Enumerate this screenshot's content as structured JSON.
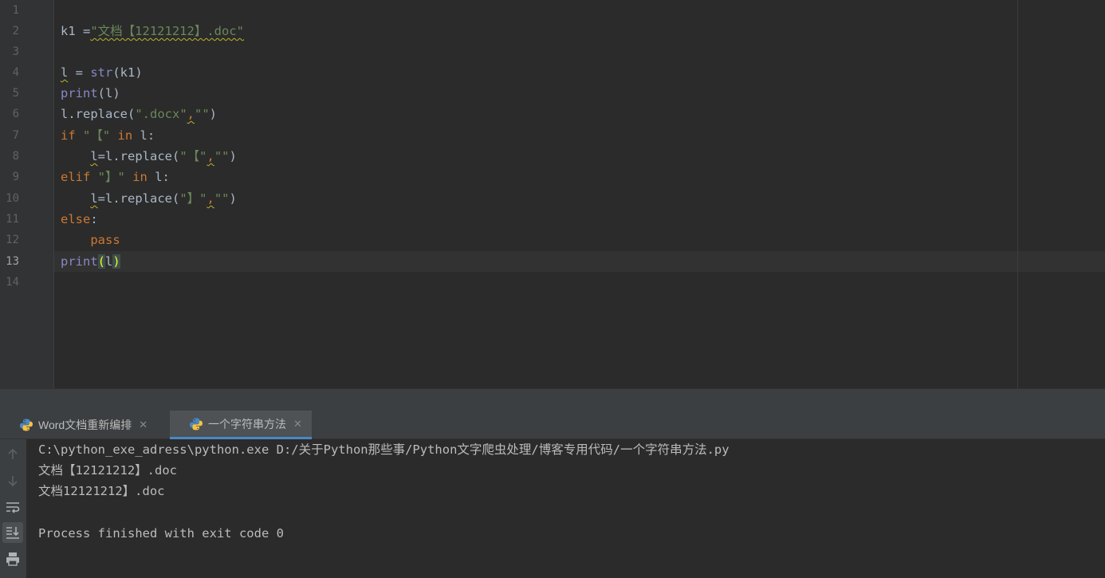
{
  "editor": {
    "line_numbers": [
      "1",
      "2",
      "3",
      "4",
      "5",
      "6",
      "7",
      "8",
      "9",
      "10",
      "11",
      "12",
      "13",
      "14"
    ],
    "current_line": "13",
    "code": {
      "l2": {
        "a": "k1 =",
        "b": "\"文档【12121212】.doc\""
      },
      "l4": {
        "a": "l",
        "b": " = ",
        "c": "str",
        "d": "(k1)"
      },
      "l5": {
        "a": "print",
        "b": "(l)"
      },
      "l6": {
        "a": "l.replace(",
        "b": "\".docx\"",
        "c": ",",
        "d": "\"\"",
        "e": ")"
      },
      "l7": {
        "a": "if",
        "b": " ",
        "c": "\"【\"",
        "d": " ",
        "e": "in",
        "f": " l:"
      },
      "l8": {
        "indent": "    ",
        "a": "l",
        "b": "=l.replace(",
        "c": "\"【\"",
        "d": ",",
        "e": "\"\"",
        "f": ")"
      },
      "l9": {
        "a": "elif",
        "b": " ",
        "c": "\"】\"",
        "d": " ",
        "e": "in",
        "f": " l:"
      },
      "l10": {
        "indent": "    ",
        "a": "l",
        "b": "=l.replace(",
        "c": "\"】\"",
        "d": ",",
        "e": "\"\"",
        "f": ")"
      },
      "l11": {
        "a": "else",
        "b": ":"
      },
      "l12": {
        "indent": "    ",
        "a": "pass"
      },
      "l13": {
        "a": "print",
        "b": "(",
        "c": "l",
        "d": ")"
      }
    }
  },
  "run_panel": {
    "tabs": [
      {
        "label": "Word文档重新编排",
        "close": "✕",
        "active": false
      },
      {
        "label": "一个字符串方法",
        "close": "✕",
        "active": true
      }
    ],
    "toolbar_icons": [
      "arrow-up-icon",
      "arrow-down-icon",
      "soft-wrap-icon",
      "scroll-to-end-icon",
      "print-icon"
    ],
    "console": [
      "C:\\python_exe_adress\\python.exe D:/关于Python那些事/Python文字爬虫处理/博客专用代码/一个字符串方法.py",
      "文档【12121212】.doc",
      "文档12121212】.doc",
      "",
      "Process finished with exit code 0"
    ]
  },
  "colors": {
    "editor_bg": "#2b2b2b",
    "keyword": "#cc7832",
    "string": "#6a8759",
    "builtin": "#8888c6",
    "identifier": "#a9b7c6",
    "brace_match": "#ffef28",
    "active_tab_underline": "#4a88c7"
  }
}
